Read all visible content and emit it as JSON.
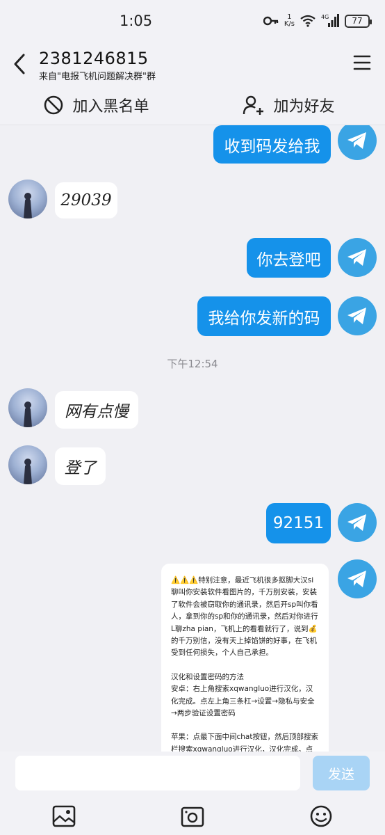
{
  "status_bar": {
    "time": "1:05",
    "net_speed_value": "1",
    "net_speed_unit": "K/s",
    "network": "4G",
    "battery": "77"
  },
  "header": {
    "title": "2381246815",
    "subtitle": "来自\"电报飞机问题解决群\"群"
  },
  "actions": {
    "blacklist": "加入黑名单",
    "add_friend": "加为好友"
  },
  "messages": [
    {
      "from": "self",
      "text": "收到码发给我"
    },
    {
      "from": "user",
      "text": "29039"
    },
    {
      "from": "self",
      "text": "你去登吧"
    },
    {
      "from": "self",
      "text": "我给你发新的码"
    },
    {
      "type": "time",
      "text": "下午12:54"
    },
    {
      "from": "user",
      "text": "网有点慢"
    },
    {
      "from": "user",
      "text": "登了"
    },
    {
      "from": "self",
      "text": "92151"
    }
  ],
  "notice": {
    "paragraph_1": "⚠️⚠️⚠️特别注意，最近飞机很多抠脚大汉si聊叫你安装软件看图片的，千万别安装，安装了软件会被窃取你的通讯录，然后开sp叫你看人，拿到你的sp和你的通讯录，然后对你进行L聊zha pian，飞机上的看看就行了，说到💰的千万别信，没有天上掉馅饼的好事，在飞机受到任何损失，个人自己承担。",
    "paragraph_2": "汉化和设置密码的方法\n安卓：右上角搜索xqwangluo进行汉化，汉化完成。点左上角三条杠→设置→隐私与安全→两步验证设置密码",
    "paragraph_3": "苹果：点最下面中间chat按钮，然后顶部搜索栏搜索xqwangluo进行汉化，汉化完成。点左"
  },
  "composer": {
    "placeholder": "",
    "send_label": "发送"
  },
  "icons": {
    "back": "chevron-left-icon",
    "menu": "hamburger-menu-icon",
    "blacklist": "block-icon",
    "add_friend": "add-user-icon",
    "self_avatar": "telegram-plane-icon",
    "image": "image-icon",
    "camera": "camera-icon",
    "emoji": "emoji-icon"
  },
  "colors": {
    "outgoing_bubble": "#1592ea",
    "self_avatar": "#3aa4e4",
    "send_button": "#a9d4f5",
    "background": "#f0f0f4"
  }
}
